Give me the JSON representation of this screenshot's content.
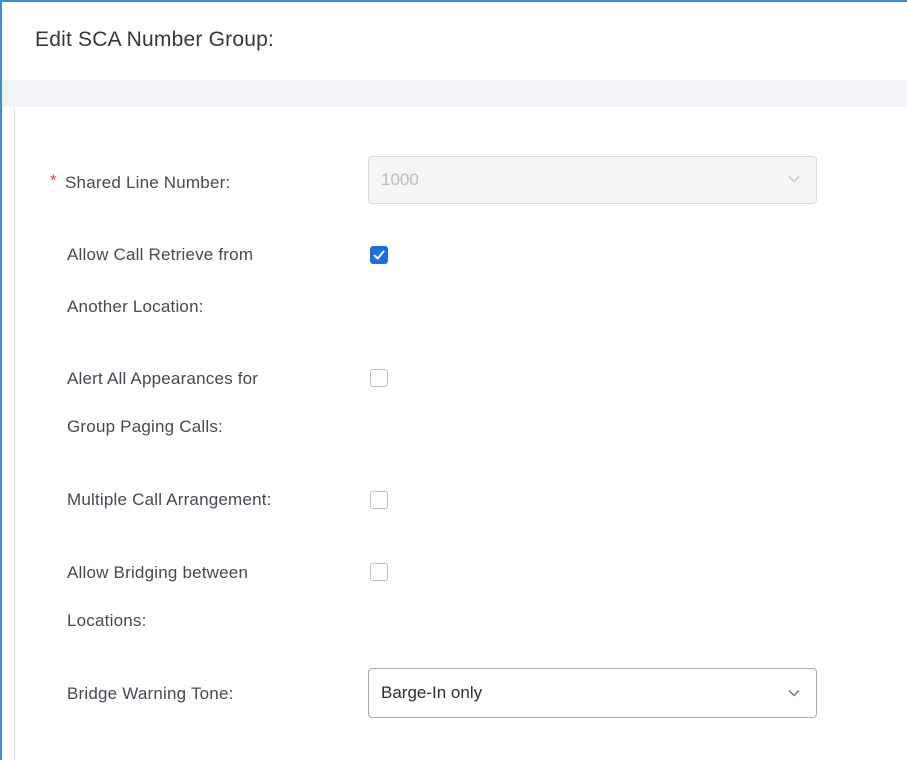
{
  "dialog": {
    "title": "Edit SCA Number Group:"
  },
  "form": {
    "required_marker": "*",
    "shared_line_number": {
      "label": "Shared Line Number:",
      "value": "1000",
      "disabled": true
    },
    "allow_call_retrieve": {
      "label_line1": "Allow Call Retrieve from",
      "label_line2": "Another Location:",
      "checked": true
    },
    "alert_all_appearances": {
      "label_line1": "Alert All Appearances for",
      "label_line2": "Group Paging Calls:",
      "checked": false
    },
    "multiple_call_arrangement": {
      "label": "Multiple Call Arrangement:",
      "checked": false
    },
    "allow_bridging": {
      "label_line1": "Allow Bridging between",
      "label_line2": "Locations:",
      "checked": false
    },
    "bridge_warning_tone": {
      "label": "Bridge Warning Tone:",
      "value": "Barge-In only"
    }
  },
  "icons": {
    "dropdown": "chevron-down-icon",
    "check": "checkmark-icon"
  },
  "colors": {
    "accent": "#1d6fe0",
    "frame_border": "#3c8dde",
    "required": "#e53c3c"
  }
}
